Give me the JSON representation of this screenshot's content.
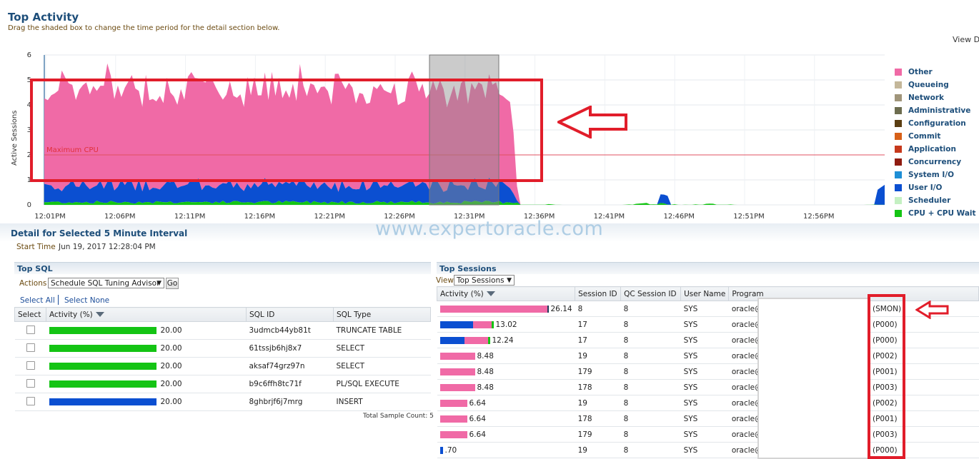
{
  "header": {
    "title": "Top Activity",
    "subtitle": "Drag the shaded box to change the time period for the detail section below.",
    "view_data_label": "View Da"
  },
  "chart_data": {
    "type": "area",
    "ylabel": "Active Sessions",
    "ylim": [
      0,
      6
    ],
    "yticks": [
      "6",
      "5",
      "4",
      "3",
      "2",
      "1",
      "0"
    ],
    "max_cpu_label": "Maximum CPU",
    "max_cpu_value": 2,
    "x_tick_labels": [
      "12:01PM",
      "12:06PM",
      "12:11PM",
      "12:16PM",
      "12:21PM",
      "12:26PM",
      "12:31PM",
      "12:36PM",
      "12:41PM",
      "12:46PM",
      "12:51PM",
      "12:56PM"
    ],
    "selected_interval": [
      "12:28PM",
      "12:33PM"
    ],
    "series": [
      {
        "name": "CPU + CPU Wait",
        "color": "#14c414",
        "approx_values": [
          0.1,
          0.12,
          0.08,
          0.15,
          0.1,
          0.12,
          0.1,
          0.08,
          0.12,
          0.1,
          0.09,
          0.1,
          0.05,
          0,
          0,
          0,
          0,
          0.05,
          0,
          0,
          0,
          0.1,
          0,
          0.05,
          0,
          0,
          0,
          0,
          0,
          0.02
        ]
      },
      {
        "name": "User I/O",
        "color": "#0b4fd1",
        "approx_values": [
          0.7,
          0.8,
          0.75,
          0.85,
          0.8,
          0.9,
          0.75,
          0.8,
          0.85,
          0.8,
          0.9,
          0.8,
          0.7,
          0,
          0,
          0,
          0,
          0.1,
          0,
          0,
          0,
          0,
          0,
          0,
          0,
          0,
          0,
          0,
          0,
          0.8
        ]
      },
      {
        "name": "Other",
        "color": "#f06aa6",
        "approx_values": [
          3.9,
          4.2,
          3.6,
          3.9,
          4.0,
          4.1,
          3.7,
          3.9,
          4.2,
          3.8,
          4.5,
          3.8,
          3.6,
          3.6,
          0,
          0,
          0,
          0,
          0,
          0,
          0,
          0,
          0,
          0,
          0,
          0,
          0,
          0,
          0,
          0
        ]
      }
    ]
  },
  "legend": [
    {
      "name": "Other",
      "color": "#f06aa6"
    },
    {
      "name": "Queueing",
      "color": "#c4b79a"
    },
    {
      "name": "Network",
      "color": "#a0957a"
    },
    {
      "name": "Administrative",
      "color": "#6d6d4f"
    },
    {
      "name": "Configuration",
      "color": "#5a3e12"
    },
    {
      "name": "Commit",
      "color": "#d76018"
    },
    {
      "name": "Application",
      "color": "#c6391c"
    },
    {
      "name": "Concurrency",
      "color": "#8f1c10"
    },
    {
      "name": "System I/O",
      "color": "#1e8fd6"
    },
    {
      "name": "User I/O",
      "color": "#0b4fd1"
    },
    {
      "name": "Scheduler",
      "color": "#c4f0c2"
    },
    {
      "name": "CPU + CPU Wait",
      "color": "#14c414"
    }
  ],
  "detail": {
    "title": "Detail for Selected 5 Minute Interval",
    "start_time_label": "Start Time",
    "start_time_value": "Jun 19, 2017 12:28:04 PM"
  },
  "watermark": "www.expertoracle.com",
  "top_sql": {
    "title": "Top SQL",
    "actions_label": "Actions",
    "action_selected": "Schedule SQL Tuning Advisor",
    "go_label": "Go",
    "select_all": "Select All",
    "select_none": "Select None",
    "columns": [
      "Select",
      "Activity (%)",
      "SQL ID",
      "SQL Type"
    ],
    "rows": [
      {
        "activity": "20.00",
        "bar_color": "#14c414",
        "sql_id": "3udmcb44yb81t",
        "sql_type": "TRUNCATE TABLE"
      },
      {
        "activity": "20.00",
        "bar_color": "#14c414",
        "sql_id": "61tssjb6hj8x7",
        "sql_type": "SELECT"
      },
      {
        "activity": "20.00",
        "bar_color": "#14c414",
        "sql_id": "aksaf74grz97n",
        "sql_type": "SELECT"
      },
      {
        "activity": "20.00",
        "bar_color": "#14c414",
        "sql_id": "b9c6ffh8tc71f",
        "sql_type": "PL/SQL EXECUTE"
      },
      {
        "activity": "20.00",
        "bar_color": "#0b4fd1",
        "sql_id": "8ghbrjf6j7mrg",
        "sql_type": "INSERT"
      }
    ],
    "total_sample": "Total Sample Count: 5"
  },
  "top_sessions": {
    "title": "Top Sessions",
    "view_label": "View",
    "view_selected": "Top Sessions",
    "columns": [
      "Activity (%)",
      "Session ID",
      "QC Session ID",
      "User Name",
      "Program"
    ],
    "rows": [
      {
        "activity": "26.14",
        "pct": 26.14,
        "blue": 0,
        "pink": 26.14,
        "green": 0,
        "sid": "8",
        "qc": "8",
        "user": "SYS",
        "program": "oracle@",
        "proc": "(SMON)"
      },
      {
        "activity": "13.02",
        "pct": 13.02,
        "blue": 8,
        "pink": 4.5,
        "green": 0.52,
        "sid": "17",
        "qc": "8",
        "user": "SYS",
        "program": "oracle@",
        "proc": "(P000)"
      },
      {
        "activity": "12.24",
        "pct": 12.24,
        "blue": 6,
        "pink": 5.7,
        "green": 0.54,
        "sid": "17",
        "qc": "8",
        "user": "SYS",
        "program": "oracle@",
        "proc": "(P000)"
      },
      {
        "activity": "8.48",
        "pct": 8.48,
        "blue": 0,
        "pink": 8.48,
        "green": 0,
        "sid": "19",
        "qc": "8",
        "user": "SYS",
        "program": "oracle@",
        "proc": "(P002)"
      },
      {
        "activity": "8.48",
        "pct": 8.48,
        "blue": 0,
        "pink": 8.48,
        "green": 0,
        "sid": "179",
        "qc": "8",
        "user": "SYS",
        "program": "oracle@",
        "proc": "(P001)"
      },
      {
        "activity": "8.48",
        "pct": 8.48,
        "blue": 0,
        "pink": 8.48,
        "green": 0,
        "sid": "178",
        "qc": "8",
        "user": "SYS",
        "program": "oracle@",
        "proc": "(P003)"
      },
      {
        "activity": "6.64",
        "pct": 6.64,
        "blue": 0,
        "pink": 6.64,
        "green": 0,
        "sid": "19",
        "qc": "8",
        "user": "SYS",
        "program": "oracle@",
        "proc": "(P002)"
      },
      {
        "activity": "6.64",
        "pct": 6.64,
        "blue": 0,
        "pink": 6.64,
        "green": 0,
        "sid": "178",
        "qc": "8",
        "user": "SYS",
        "program": "oracle@",
        "proc": "(P001)"
      },
      {
        "activity": "6.64",
        "pct": 6.64,
        "blue": 0,
        "pink": 6.64,
        "green": 0,
        "sid": "179",
        "qc": "8",
        "user": "SYS",
        "program": "oracle@",
        "proc": "(P003)"
      },
      {
        "activity": ".70",
        "pct": 0.7,
        "blue": 0.7,
        "pink": 0,
        "green": 0,
        "sid": "19",
        "qc": "8",
        "user": "SYS",
        "program": "oracle@",
        "proc": "(P000)"
      }
    ]
  }
}
